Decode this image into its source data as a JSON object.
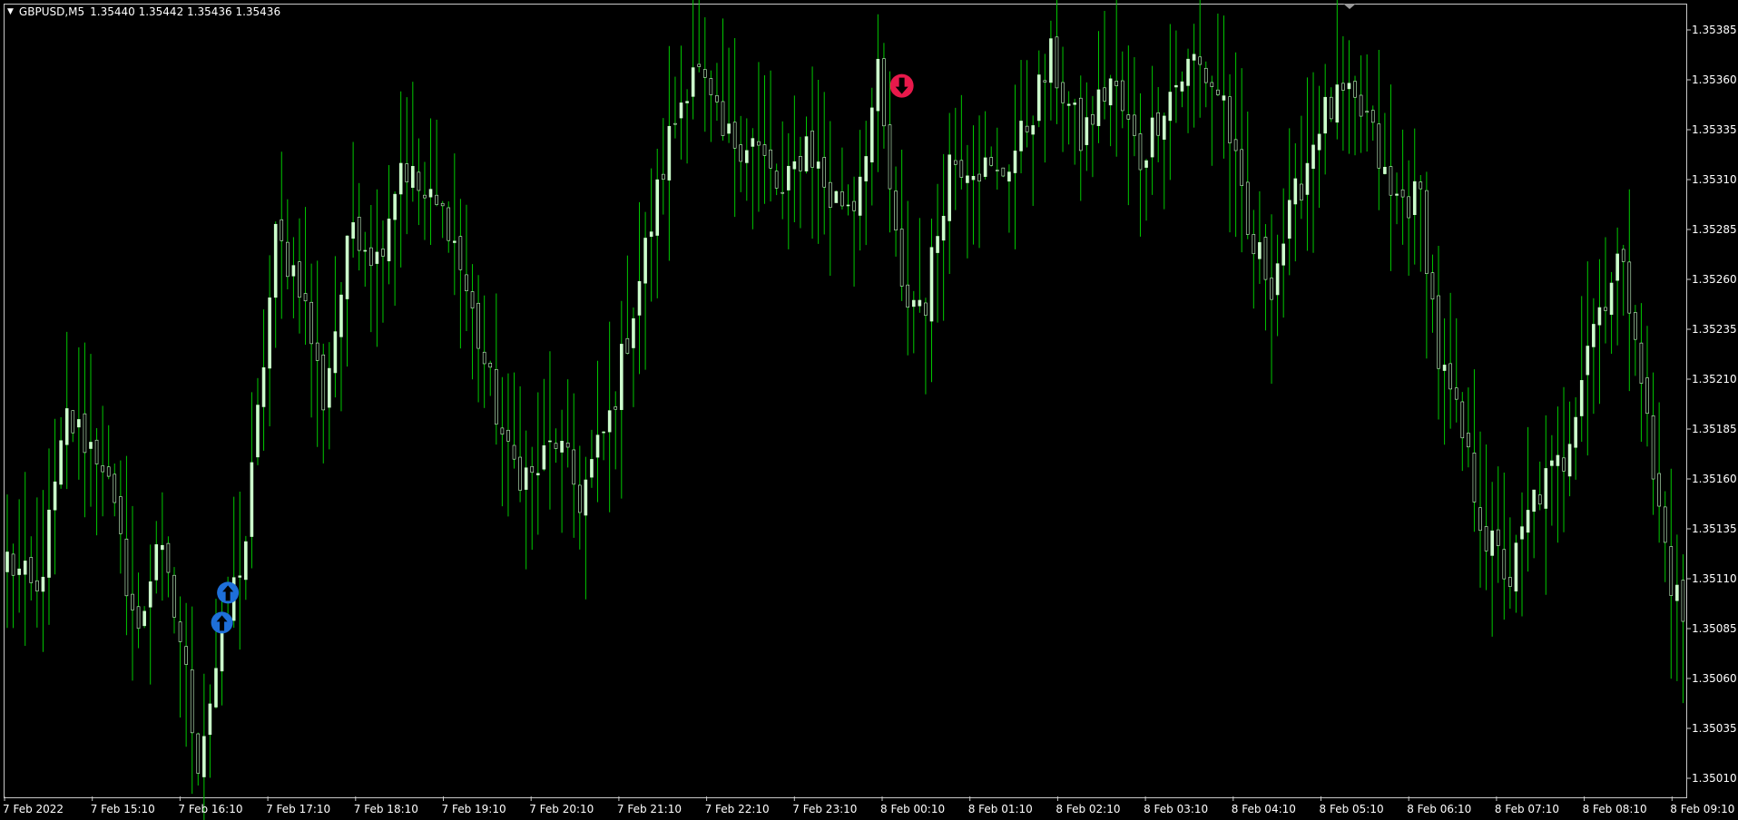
{
  "header": {
    "symbol": "GBPUSD,M5",
    "quote": "1.35440 1.35442 1.35436 1.35436"
  },
  "colors": {
    "background": "#000000",
    "candle_up": "#ccffcc",
    "candle_wick": "#00c800",
    "buy_arrow": "#1e6fd9",
    "sell_arrow": "#e8194b",
    "axis_text": "#ffffff",
    "frame": "#c8c8c8"
  },
  "chart_data": {
    "type": "candlestick",
    "ylim": [
      1.35,
      1.354
    ],
    "y_ticks": [
      "1.35385",
      "1.35360",
      "1.35335",
      "1.35310",
      "1.35285",
      "1.35260",
      "1.35235",
      "1.35210",
      "1.35185",
      "1.35160",
      "1.35135",
      "1.35110",
      "1.35085",
      "1.35060",
      "1.35035",
      "1.35010"
    ],
    "x_ticks": [
      "7 Feb 2022",
      "7 Feb 15:10",
      "7 Feb 16:10",
      "7 Feb 17:10",
      "7 Feb 18:10",
      "7 Feb 19:10",
      "7 Feb 20:10",
      "7 Feb 21:10",
      "7 Feb 22:10",
      "7 Feb 23:10",
      "8 Feb 00:10",
      "8 Feb 01:10",
      "8 Feb 02:10",
      "8 Feb 03:10",
      "8 Feb 04:10",
      "8 Feb 05:10",
      "8 Feb 06:10",
      "8 Feb 07:10",
      "8 Feb 08:10",
      "8 Feb 09:10"
    ],
    "close_anchors": [
      [
        0,
        1.3512
      ],
      [
        5,
        1.351
      ],
      [
        10,
        1.3519
      ],
      [
        16,
        1.3517
      ],
      [
        22,
        1.3508
      ],
      [
        25,
        1.3513
      ],
      [
        29,
        1.3508
      ],
      [
        32,
        1.3502
      ],
      [
        36,
        1.3508
      ],
      [
        40,
        1.3513
      ],
      [
        45,
        1.3528
      ],
      [
        49,
        1.3526
      ],
      [
        53,
        1.352
      ],
      [
        58,
        1.3529
      ],
      [
        62,
        1.3527
      ],
      [
        66,
        1.3532
      ],
      [
        70,
        1.353
      ],
      [
        74,
        1.3529
      ],
      [
        79,
        1.3523
      ],
      [
        84,
        1.3517
      ],
      [
        88,
        1.3516
      ],
      [
        92,
        1.3518
      ],
      [
        96,
        1.3515
      ],
      [
        101,
        1.3519
      ],
      [
        106,
        1.3526
      ],
      [
        111,
        1.3533
      ],
      [
        115,
        1.3537
      ],
      [
        120,
        1.3533
      ],
      [
        125,
        1.3533
      ],
      [
        130,
        1.353
      ],
      [
        134,
        1.3533
      ],
      [
        138,
        1.353
      ],
      [
        142,
        1.353
      ],
      [
        146,
        1.3536
      ],
      [
        150,
        1.3525
      ],
      [
        154,
        1.3525
      ],
      [
        158,
        1.3532
      ],
      [
        162,
        1.3532
      ],
      [
        166,
        1.3531
      ],
      [
        170,
        1.3533
      ],
      [
        175,
        1.3537
      ],
      [
        180,
        1.3533
      ],
      [
        185,
        1.3536
      ],
      [
        190,
        1.3532
      ],
      [
        194,
        1.3535
      ],
      [
        199,
        1.3537
      ],
      [
        204,
        1.3535
      ],
      [
        208,
        1.3528
      ],
      [
        212,
        1.3526
      ],
      [
        216,
        1.353
      ],
      [
        220,
        1.3534
      ],
      [
        224,
        1.3535
      ],
      [
        228,
        1.3534
      ],
      [
        232,
        1.353
      ],
      [
        237,
        1.353
      ],
      [
        240,
        1.3522
      ],
      [
        244,
        1.3518
      ],
      [
        248,
        1.3513
      ],
      [
        252,
        1.3511
      ],
      [
        256,
        1.3515
      ],
      [
        261,
        1.3517
      ],
      [
        265,
        1.3523
      ],
      [
        270,
        1.3527
      ],
      [
        273,
        1.3524
      ],
      [
        276,
        1.3516
      ],
      [
        279,
        1.3511
      ],
      [
        281,
        1.3509
      ]
    ],
    "signals": [
      {
        "type": "buy",
        "bar": 36,
        "price": 1.35088
      },
      {
        "type": "buy",
        "bar": 37,
        "price": 1.35103
      },
      {
        "type": "sell",
        "bar": 150,
        "price": 1.35357
      }
    ]
  }
}
